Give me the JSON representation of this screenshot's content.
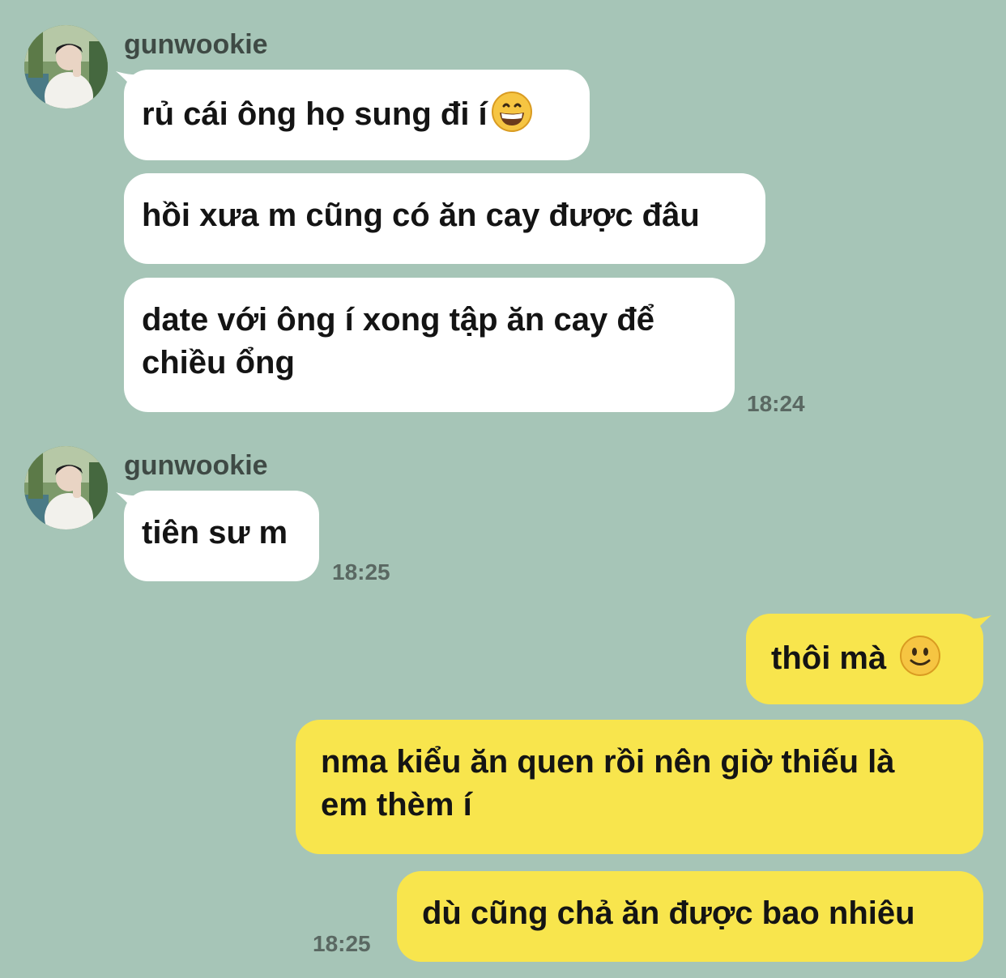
{
  "theme": {
    "background": "#a6c5b7",
    "incoming_bubble": "#ffffff",
    "outgoing_bubble": "#f8e54d"
  },
  "groups": [
    {
      "sender": "gunwookie",
      "messages": [
        {
          "text": "rủ cái ông họ sung đi í",
          "emoji": "grinning-face-icon"
        },
        {
          "text": "hồi xưa m cũng có ăn cay được đâu"
        },
        {
          "line1": "date với ông í xong tập ăn cay để",
          "line2": "chiều ổng"
        }
      ],
      "time": "18:24"
    },
    {
      "sender": "gunwookie",
      "messages": [
        {
          "text": "tiên sư m"
        }
      ],
      "time": "18:25"
    }
  ],
  "outgoing": {
    "messages": [
      {
        "text": "thôi mà",
        "emoji": "slightly-smiling-face-icon"
      },
      {
        "line1": "nma kiểu ăn quen rồi nên giờ thiếu là",
        "line2": "em thèm í"
      },
      {
        "text": "dù cũng chả ăn được bao nhiêu"
      }
    ],
    "time": "18:25"
  }
}
